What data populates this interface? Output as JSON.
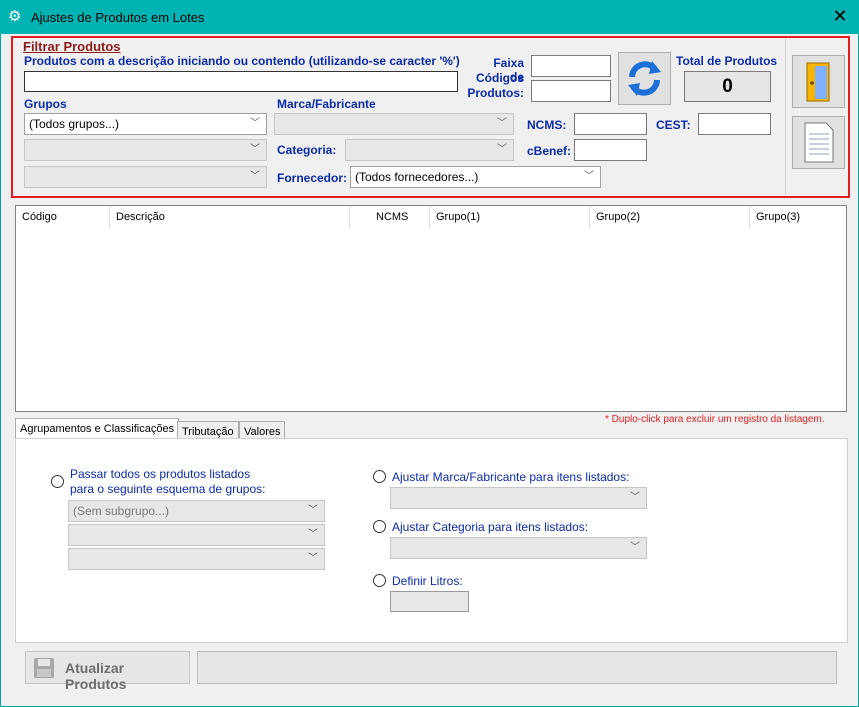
{
  "window": {
    "title": "Ajustes de Produtos em Lotes"
  },
  "filter": {
    "title": "Filtrar Produtos",
    "desc_label": "Produtos com a descrição iniciando ou contendo (utilizando-se caracter '%')",
    "desc_value": "",
    "faixa_label_1": "Faixa de",
    "faixa_label_2": "Códigos",
    "faixa_label_3": "Produtos:",
    "total_label": "Total de Produtos",
    "total_value": "0",
    "grupos_label": "Grupos",
    "grupos_value": "(Todos grupos...)",
    "marca_label": "Marca/Fabricante",
    "categoria_label": "Categoria:",
    "fornecedor_label": "Fornecedor:",
    "fornecedor_value": "(Todos fornecedores...)",
    "ncms_label": "NCMS:",
    "cest_label": "CEST:",
    "cbenef_label": "cBenef:"
  },
  "table": {
    "columns": [
      "Código",
      "Descrição",
      "NCMS",
      "Grupo(1)",
      "Grupo(2)",
      "Grupo(3)"
    ],
    "rows": []
  },
  "note": "* Duplo-click para excluir um registro da listagem.",
  "tabs": [
    "Agrupamentos e Classificações",
    "Tributação",
    "Valores"
  ],
  "panel": {
    "passar_line1": "Passar todos os produtos listados",
    "passar_line2": "para o seguinte esquema de grupos:",
    "subgrupo_value": "(Sem subgrupo...)",
    "ajustar_marca": "Ajustar Marca/Fabricante para itens listados:",
    "ajustar_categoria": "Ajustar Categoria para itens listados:",
    "definir_litros": "Definir Litros:"
  },
  "actions": {
    "atualizar": "Atualizar Produtos"
  },
  "colors": {
    "titlebar": "#00b3b3",
    "accent_blue": "#0b2aa8",
    "highlight_red": "#e02020"
  }
}
